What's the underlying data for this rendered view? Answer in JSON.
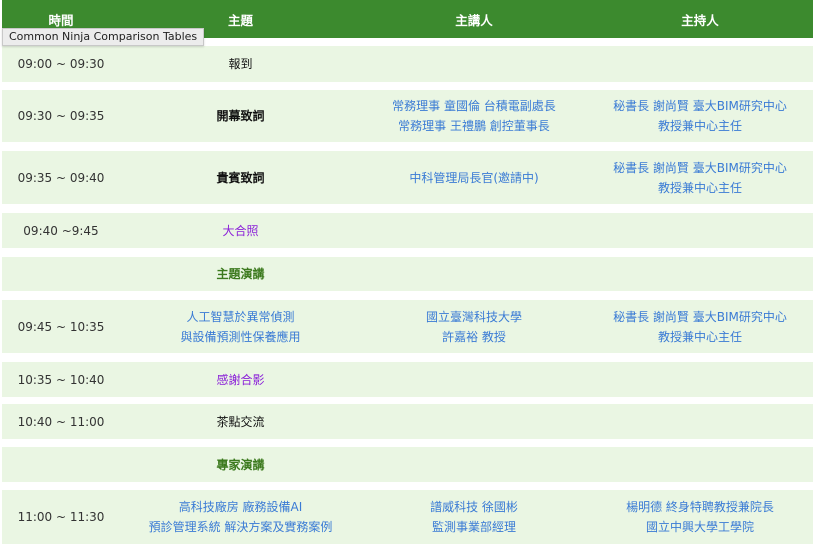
{
  "header": {
    "time": "時間",
    "topic": "主題",
    "speaker": "主講人",
    "host": "主持人"
  },
  "tooltip": "Common Ninja Comparison Tables",
  "rows": [
    {
      "time": "09:00 ~ 09:30",
      "topic": [
        "報到"
      ],
      "speaker": [],
      "host": []
    },
    {
      "time": "09:30 ~ 09:35",
      "topic": [
        "開幕致詞"
      ],
      "speaker": [
        "常務理事 童國倫 台積電副處長",
        "常務理事 王禮鵬 創控董事長"
      ],
      "host": [
        "秘書長 謝尚賢 臺大BIM研究中心",
        "教授兼中心主任"
      ]
    },
    {
      "time": "09:35 ~ 09:40",
      "topic": [
        "貴賓致詞"
      ],
      "speaker": [
        "中科管理局長官(邀請中)"
      ],
      "host": [
        "秘書長 謝尚賢 臺大BIM研究中心",
        "教授兼中心主任"
      ]
    },
    {
      "time": "09:40 ~9:45",
      "topic": [
        "大合照"
      ],
      "speaker": [],
      "host": []
    },
    {
      "time": "",
      "topic": [
        "主題演講"
      ],
      "speaker": [],
      "host": []
    },
    {
      "time": "09:45 ~ 10:35",
      "topic": [
        "人工智慧於異常偵測",
        "與設備預測性保養應用"
      ],
      "speaker": [
        "國立臺灣科技大學",
        "許嘉裕 教授"
      ],
      "host": [
        "秘書長 謝尚賢 臺大BIM研究中心",
        "教授兼中心主任"
      ]
    },
    {
      "time": "10:35 ~ 10:40",
      "topic": [
        "感謝合影"
      ],
      "speaker": [],
      "host": []
    },
    {
      "time": "10:40 ~ 11:00",
      "topic": [
        "茶點交流"
      ],
      "speaker": [],
      "host": []
    },
    {
      "time": "",
      "topic": [
        "專家演講"
      ],
      "speaker": [],
      "host": []
    },
    {
      "time": "11:00 ~ 11:30",
      "topic": [
        "高科技廠房 廠務設備AI",
        "預診管理系統 解決方案及實務案例"
      ],
      "speaker": [
        "譜威科技 徐國彬",
        "監測事業部經理"
      ],
      "host": [
        "楊明德 終身特聘教授兼院長",
        "國立中興大學工學院"
      ]
    }
  ],
  "colors": {
    "header_bg": "#3c8a2e",
    "row_bg": "#eaf6e3",
    "link_blue": "#3a7bd5",
    "highlight_purple": "#8a1fd8",
    "section_green": "#3c7a1e"
  }
}
